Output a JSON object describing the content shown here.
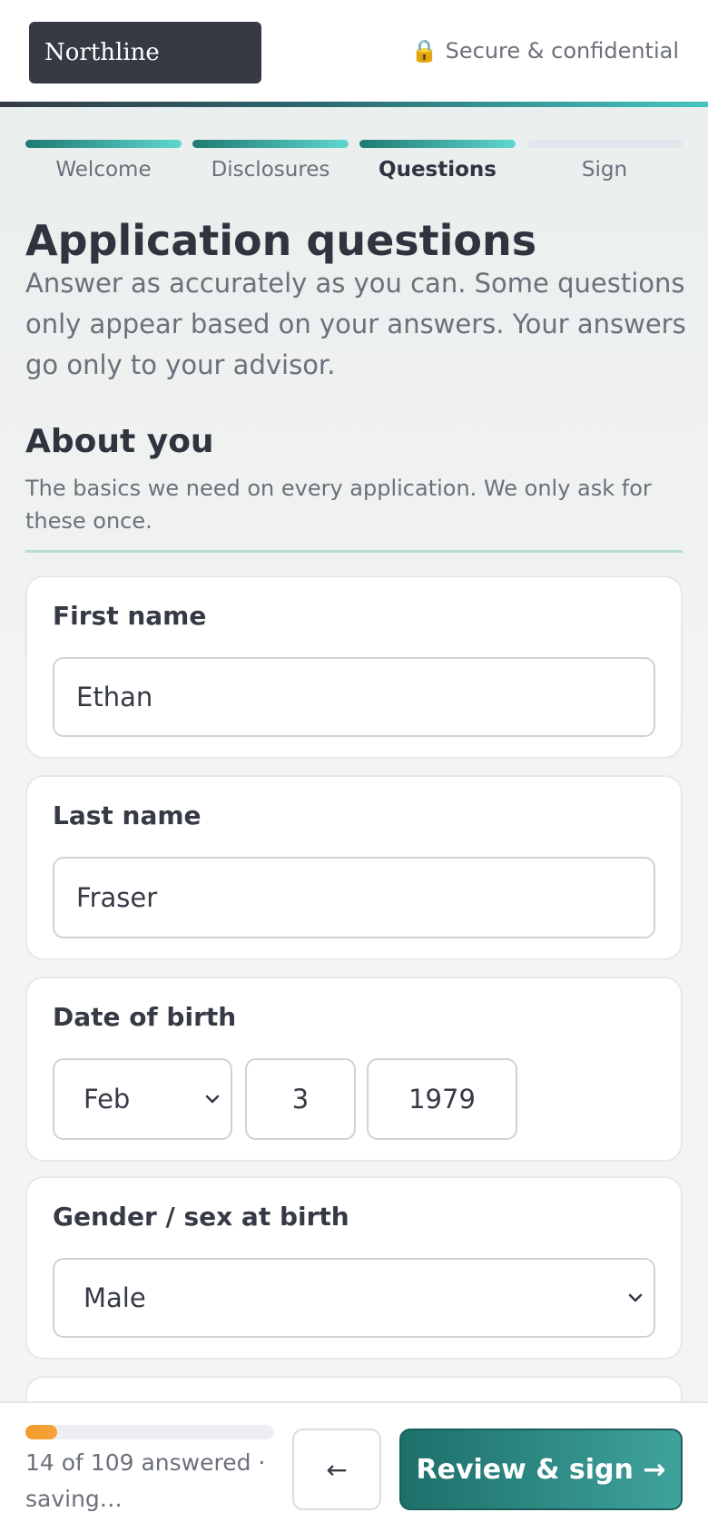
{
  "header": {
    "brand": "Northline",
    "secure_icon": "lock-icon",
    "secure_text": "Secure & confidential"
  },
  "stepper": {
    "steps": [
      {
        "label": "Welcome",
        "state": "done"
      },
      {
        "label": "Disclosures",
        "state": "done"
      },
      {
        "label": "Questions",
        "state": "current"
      },
      {
        "label": "Sign",
        "state": "todo"
      }
    ]
  },
  "page": {
    "title": "Application questions",
    "subtitle": "Answer as accurately as you can. Some questions only appear based on your answers. Your answers go only to your advisor."
  },
  "section": {
    "title": "About you",
    "subtitle": "The basics we need on every application. We only ask for these once."
  },
  "questions": {
    "first_name": {
      "label": "First name",
      "value": "Ethan"
    },
    "last_name": {
      "label": "Last name",
      "value": "Fraser"
    },
    "dob": {
      "label": "Date of birth",
      "month": "Feb",
      "day": "3",
      "year": "1979"
    },
    "gender": {
      "label": "Gender / sex at birth",
      "value": "Male"
    }
  },
  "footer": {
    "progress_answered": 14,
    "progress_total": 109,
    "status": "14 of 109 answered · saving…",
    "back_label": "←",
    "review_label": "Review & sign →"
  },
  "colors": {
    "brand_dark": "#363a45",
    "accent_teal": "#1d6f6a",
    "progress_orange": "#f39a2a"
  }
}
